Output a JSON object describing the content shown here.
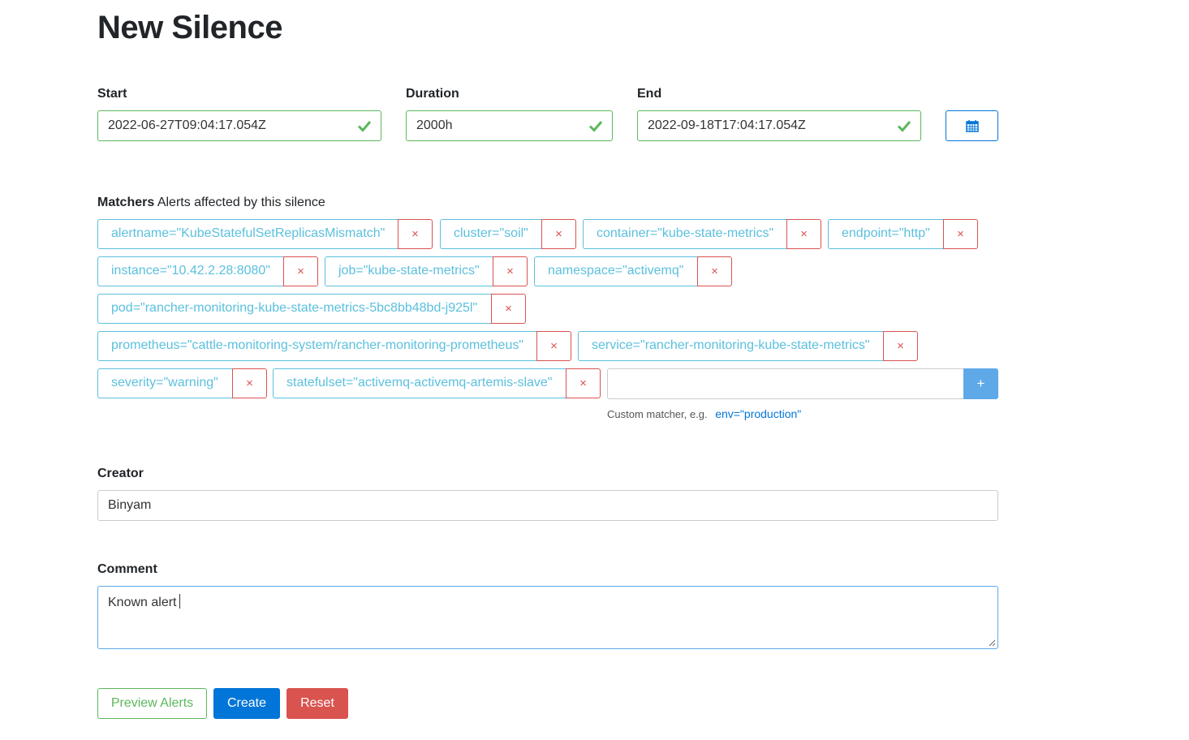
{
  "page": {
    "title": "New Silence"
  },
  "form": {
    "start": {
      "label": "Start",
      "value": "2022-06-27T09:04:17.054Z",
      "valid": true
    },
    "duration": {
      "label": "Duration",
      "value": "2000h",
      "valid": true
    },
    "end": {
      "label": "End",
      "value": "2022-09-18T17:04:17.054Z",
      "valid": true
    },
    "calendar_button": {
      "icon": "calendar-icon"
    },
    "matchers": {
      "label": "Matchers",
      "description": "Alerts affected by this silence",
      "items": [
        {
          "text": "alertname=\"KubeStatefulSetReplicasMismatch\"",
          "remove": "×"
        },
        {
          "text": "cluster=\"soil\"",
          "remove": "×"
        },
        {
          "text": "container=\"kube-state-metrics\"",
          "remove": "×"
        },
        {
          "text": "endpoint=\"http\"",
          "remove": "×"
        },
        {
          "text": "instance=\"10.42.2.28:8080\"",
          "remove": "×"
        },
        {
          "text": "job=\"kube-state-metrics\"",
          "remove": "×"
        },
        {
          "text": "namespace=\"activemq\"",
          "remove": "×"
        },
        {
          "text": "pod=\"rancher-monitoring-kube-state-metrics-5bc8bb48bd-j925l\"",
          "remove": "×"
        },
        {
          "text": "prometheus=\"cattle-monitoring-system/rancher-monitoring-prometheus\"",
          "remove": "×"
        },
        {
          "text": "service=\"rancher-monitoring-kube-state-metrics\"",
          "remove": "×"
        },
        {
          "text": "severity=\"warning\"",
          "remove": "×"
        },
        {
          "text": "statefulset=\"activemq-activemq-artemis-slave\"",
          "remove": "×"
        }
      ],
      "custom_input": {
        "value": "",
        "placeholder": ""
      },
      "add_label": "+",
      "hint": "Custom matcher, e.g.",
      "hint_example": "env=\"production\""
    },
    "creator": {
      "label": "Creator",
      "value": "Binyam"
    },
    "comment": {
      "label": "Comment",
      "value": "Known alert"
    }
  },
  "actions": {
    "preview": "Preview Alerts",
    "create": "Create",
    "reset": "Reset"
  },
  "colors": {
    "valid": "#5cb85c",
    "info": "#5bc0de",
    "danger": "#d9534f",
    "primary": "#0275d8"
  }
}
